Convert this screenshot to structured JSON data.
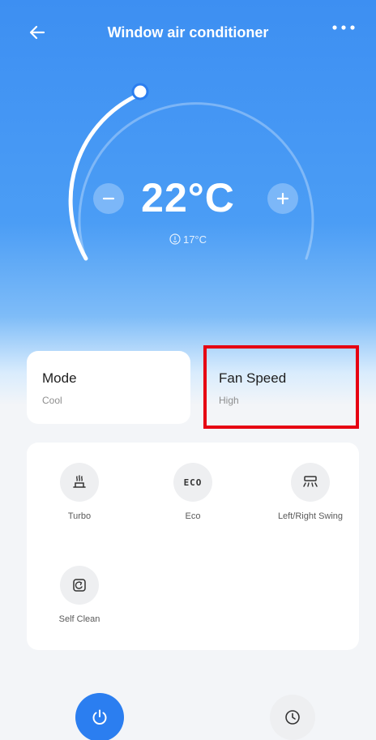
{
  "header": {
    "title": "Window air conditioner",
    "back_icon": "back-arrow-icon",
    "more_icon": "more-dots-icon"
  },
  "thermostat": {
    "set_temperature": "22°C",
    "indoor_temperature": "17°C",
    "indoor_icon": "indoor-thermometer-icon",
    "minus_icon": "minus-icon",
    "plus_icon": "plus-icon"
  },
  "cards": {
    "mode": {
      "label": "Mode",
      "value": "Cool"
    },
    "fan_speed": {
      "label": "Fan Speed",
      "value": "High"
    }
  },
  "features": [
    {
      "label": "Turbo",
      "icon": "turbo-icon"
    },
    {
      "label": "Eco",
      "icon": "eco-icon",
      "icon_text": "ECO"
    },
    {
      "label": "Left/Right Swing",
      "icon": "swing-icon"
    },
    {
      "label": "Self Clean",
      "icon": "self-clean-icon"
    }
  ],
  "bottom_bar": {
    "power_icon": "power-icon",
    "timer_icon": "timer-icon"
  },
  "colors": {
    "accent": "#2b7ef0",
    "hero_top": "#3d8ff2",
    "highlight": "#e60012"
  }
}
